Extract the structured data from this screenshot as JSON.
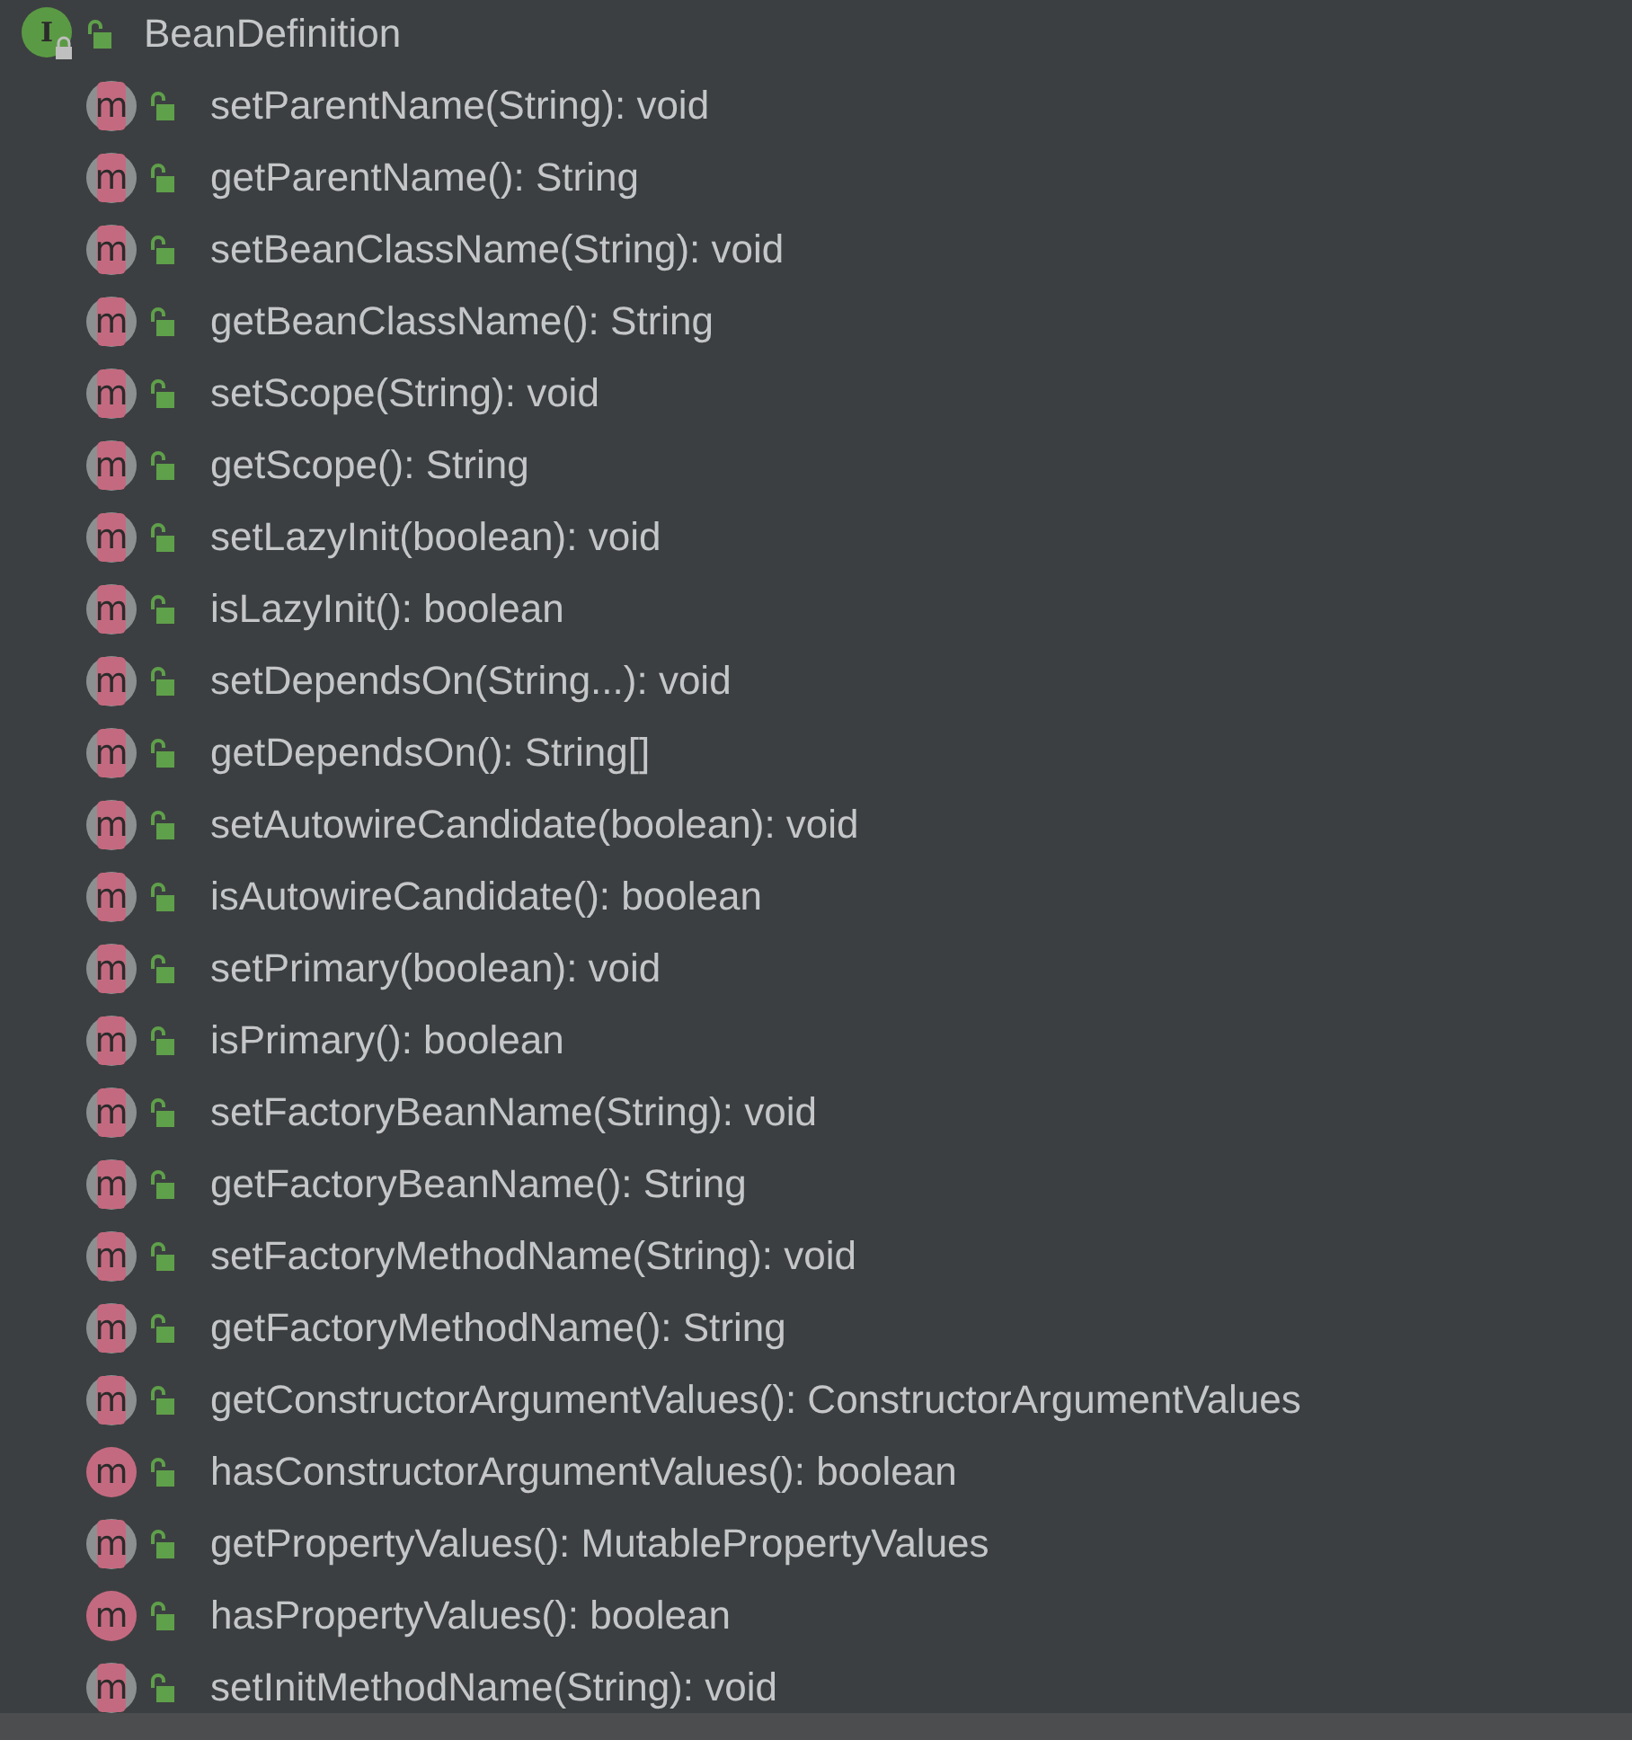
{
  "tree": {
    "label": "BeanDefinition",
    "kind": "interface",
    "icon_letter": "I",
    "children": [
      {
        "label": "setParentName(String): void",
        "kind": "abstract",
        "icon_letter": "m"
      },
      {
        "label": "getParentName(): String",
        "kind": "abstract",
        "icon_letter": "m"
      },
      {
        "label": "setBeanClassName(String): void",
        "kind": "abstract",
        "icon_letter": "m"
      },
      {
        "label": "getBeanClassName(): String",
        "kind": "abstract",
        "icon_letter": "m"
      },
      {
        "label": "setScope(String): void",
        "kind": "abstract",
        "icon_letter": "m"
      },
      {
        "label": "getScope(): String",
        "kind": "abstract",
        "icon_letter": "m"
      },
      {
        "label": "setLazyInit(boolean): void",
        "kind": "abstract",
        "icon_letter": "m"
      },
      {
        "label": "isLazyInit(): boolean",
        "kind": "abstract",
        "icon_letter": "m"
      },
      {
        "label": "setDependsOn(String...): void",
        "kind": "abstract",
        "icon_letter": "m"
      },
      {
        "label": "getDependsOn(): String[]",
        "kind": "abstract",
        "icon_letter": "m"
      },
      {
        "label": "setAutowireCandidate(boolean): void",
        "kind": "abstract",
        "icon_letter": "m"
      },
      {
        "label": "isAutowireCandidate(): boolean",
        "kind": "abstract",
        "icon_letter": "m"
      },
      {
        "label": "setPrimary(boolean): void",
        "kind": "abstract",
        "icon_letter": "m"
      },
      {
        "label": "isPrimary(): boolean",
        "kind": "abstract",
        "icon_letter": "m"
      },
      {
        "label": "setFactoryBeanName(String): void",
        "kind": "abstract",
        "icon_letter": "m"
      },
      {
        "label": "getFactoryBeanName(): String",
        "kind": "abstract",
        "icon_letter": "m"
      },
      {
        "label": "setFactoryMethodName(String): void",
        "kind": "abstract",
        "icon_letter": "m"
      },
      {
        "label": "getFactoryMethodName(): String",
        "kind": "abstract",
        "icon_letter": "m"
      },
      {
        "label": "getConstructorArgumentValues(): ConstructorArgumentValues",
        "kind": "abstract",
        "icon_letter": "m"
      },
      {
        "label": "hasConstructorArgumentValues(): boolean",
        "kind": "default",
        "icon_letter": "m"
      },
      {
        "label": "getPropertyValues(): MutablePropertyValues",
        "kind": "abstract",
        "icon_letter": "m"
      },
      {
        "label": "hasPropertyValues(): boolean",
        "kind": "default",
        "icon_letter": "m"
      },
      {
        "label": "setInitMethodName(String): void",
        "kind": "abstract",
        "icon_letter": "m"
      }
    ]
  }
}
